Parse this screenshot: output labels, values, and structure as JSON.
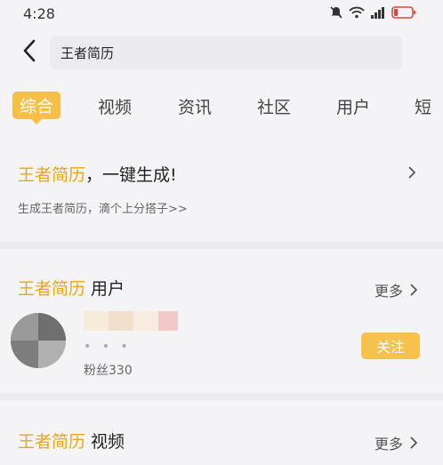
{
  "status_bar": {
    "time": "4:28"
  },
  "search": {
    "query": "王者简历"
  },
  "tabs": [
    {
      "label": "综合"
    },
    {
      "label": "视频"
    },
    {
      "label": "资讯"
    },
    {
      "label": "社区"
    },
    {
      "label": "用户"
    },
    {
      "label": "短"
    }
  ],
  "resume_card": {
    "title_highlight": "王者简历",
    "title_rest": "，一键生成!",
    "subtitle": "生成王者简历，滴个上分搭子>>"
  },
  "users_section": {
    "title_highlight": "王者简历",
    "title_rest": " 用户",
    "more_label": "更多",
    "user": {
      "dots": "• • •",
      "fans": "粉丝330",
      "follow_label": "关注"
    }
  },
  "video_section": {
    "title_highlight": "王者简历",
    "title_rest": " 视频",
    "more_label": "更多"
  },
  "colors": {
    "accent": "#f6bf45",
    "highlight_text": "#e6a817"
  }
}
